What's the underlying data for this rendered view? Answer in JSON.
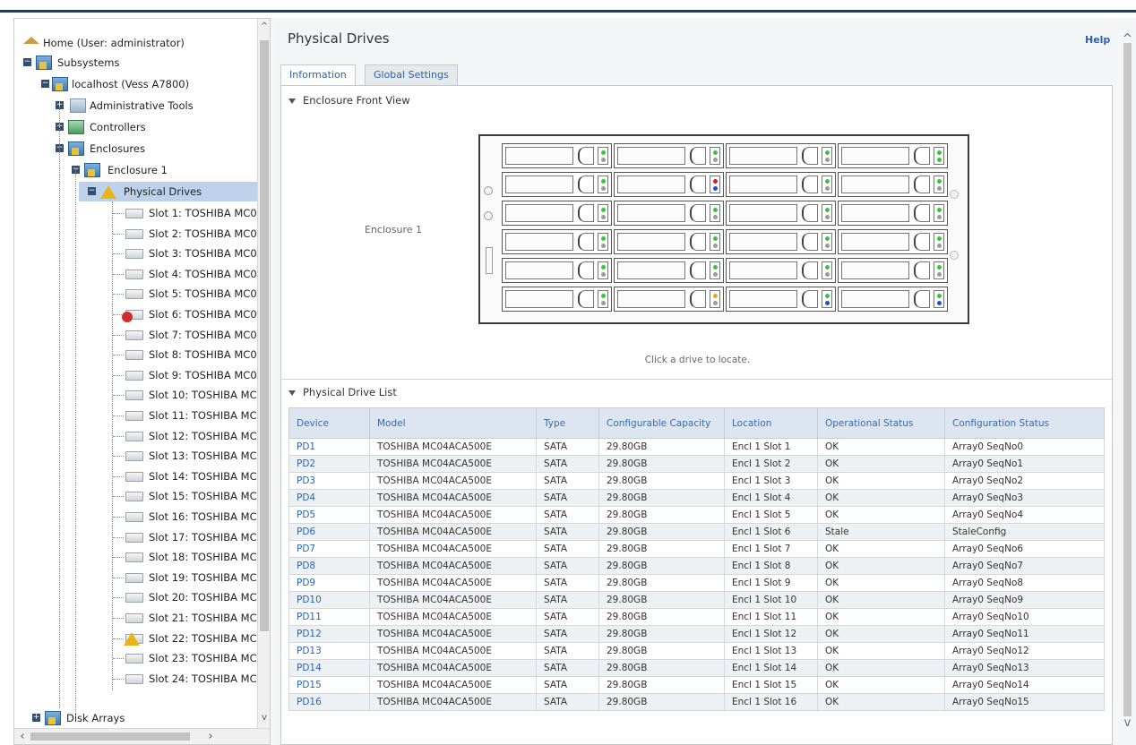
{
  "tree": {
    "home": "Home (User: administrator)",
    "subsystems": "Subsystems",
    "localhost": "localhost (Vess A7800)",
    "admin_tools": "Administrative Tools",
    "controllers": "Controllers",
    "enclosures": "Enclosures",
    "enclosure1": "Enclosure 1",
    "physical_drives": "Physical Drives",
    "disk_arrays": "Disk Arrays",
    "slots": [
      "Slot 1: TOSHIBA MC0",
      "Slot 2: TOSHIBA MC0",
      "Slot 3: TOSHIBA MC0",
      "Slot 4: TOSHIBA MC0",
      "Slot 5: TOSHIBA MC0",
      "Slot 6: TOSHIBA MC0",
      "Slot 7: TOSHIBA MC0",
      "Slot 8: TOSHIBA MC0",
      "Slot 9: TOSHIBA MC0",
      "Slot 10: TOSHIBA MC",
      "Slot 11: TOSHIBA MC",
      "Slot 12: TOSHIBA MC",
      "Slot 13: TOSHIBA MC",
      "Slot 14: TOSHIBA MC",
      "Slot 15: TOSHIBA MC",
      "Slot 16: TOSHIBA MC",
      "Slot 17: TOSHIBA MC",
      "Slot 18: TOSHIBA MC",
      "Slot 19: TOSHIBA MC",
      "Slot 20: TOSHIBA MC",
      "Slot 21: TOSHIBA MC",
      "Slot 22: TOSHIBA MC",
      "Slot 23: TOSHIBA MC",
      "Slot 24: TOSHIBA MC"
    ],
    "slot_status": [
      "ok",
      "ok",
      "ok",
      "ok",
      "ok",
      "error",
      "ok",
      "ok",
      "ok",
      "ok",
      "ok",
      "ok",
      "ok",
      "ok",
      "ok",
      "ok",
      "ok",
      "ok",
      "ok",
      "ok",
      "ok",
      "warning",
      "ok",
      "ok"
    ]
  },
  "header": {
    "title": "Physical Drives",
    "help": "Help"
  },
  "tabs": [
    {
      "label": "Information",
      "active": true
    },
    {
      "label": "Global Settings",
      "active": false
    }
  ],
  "front_view": {
    "heading": "Enclosure Front View",
    "enclosure_label": "Enclosure 1",
    "hint": "Click a drive to locate.",
    "led_colors": {
      "green": "#3cc43c",
      "red": "#d02020",
      "blue": "#2050c8",
      "orange": "#e8a030",
      "gray": "#9a9a9a"
    },
    "bays": [
      [
        [
          "green",
          "gray"
        ],
        [
          "green",
          "gray"
        ],
        [
          "green",
          "gray"
        ],
        [
          "green",
          "green"
        ]
      ],
      [
        [
          "green",
          "gray"
        ],
        [
          "red",
          "blue"
        ],
        [
          "green",
          "gray"
        ],
        [
          "green",
          "gray"
        ]
      ],
      [
        [
          "green",
          "gray"
        ],
        [
          "green",
          "gray"
        ],
        [
          "green",
          "gray"
        ],
        [
          "green",
          "gray"
        ]
      ],
      [
        [
          "green",
          "gray"
        ],
        [
          "green",
          "gray"
        ],
        [
          "green",
          "gray"
        ],
        [
          "green",
          "gray"
        ]
      ],
      [
        [
          "green",
          "gray"
        ],
        [
          "green",
          "gray"
        ],
        [
          "green",
          "gray"
        ],
        [
          "green",
          "gray"
        ]
      ],
      [
        [
          "green",
          "gray"
        ],
        [
          "orange",
          "gray"
        ],
        [
          "green",
          "blue"
        ],
        [
          "green",
          "blue"
        ]
      ]
    ]
  },
  "drive_list": {
    "heading": "Physical Drive List",
    "columns": [
      "Device",
      "Model",
      "Type",
      "Configurable Capacity",
      "Location",
      "Operational Status",
      "Configuration Status"
    ],
    "rows": [
      [
        "PD1",
        "TOSHIBA MC04ACA500E",
        "SATA",
        "29.80GB",
        "Encl 1 Slot 1",
        "OK",
        "Array0 SeqNo0"
      ],
      [
        "PD2",
        "TOSHIBA MC04ACA500E",
        "SATA",
        "29.80GB",
        "Encl 1 Slot 2",
        "OK",
        "Array0 SeqNo1"
      ],
      [
        "PD3",
        "TOSHIBA MC04ACA500E",
        "SATA",
        "29.80GB",
        "Encl 1 Slot 3",
        "OK",
        "Array0 SeqNo2"
      ],
      [
        "PD4",
        "TOSHIBA MC04ACA500E",
        "SATA",
        "29.80GB",
        "Encl 1 Slot 4",
        "OK",
        "Array0 SeqNo3"
      ],
      [
        "PD5",
        "TOSHIBA MC04ACA500E",
        "SATA",
        "29.80GB",
        "Encl 1 Slot 5",
        "OK",
        "Array0 SeqNo4"
      ],
      [
        "PD6",
        "TOSHIBA MC04ACA500E",
        "SATA",
        "29.80GB",
        "Encl 1 Slot 6",
        "Stale",
        "StaleConfig"
      ],
      [
        "PD7",
        "TOSHIBA MC04ACA500E",
        "SATA",
        "29.80GB",
        "Encl 1 Slot 7",
        "OK",
        "Array0 SeqNo6"
      ],
      [
        "PD8",
        "TOSHIBA MC04ACA500E",
        "SATA",
        "29.80GB",
        "Encl 1 Slot 8",
        "OK",
        "Array0 SeqNo7"
      ],
      [
        "PD9",
        "TOSHIBA MC04ACA500E",
        "SATA",
        "29.80GB",
        "Encl 1 Slot 9",
        "OK",
        "Array0 SeqNo8"
      ],
      [
        "PD10",
        "TOSHIBA MC04ACA500E",
        "SATA",
        "29.80GB",
        "Encl 1 Slot 10",
        "OK",
        "Array0 SeqNo9"
      ],
      [
        "PD11",
        "TOSHIBA MC04ACA500E",
        "SATA",
        "29.80GB",
        "Encl 1 Slot 11",
        "OK",
        "Array0 SeqNo10"
      ],
      [
        "PD12",
        "TOSHIBA MC04ACA500E",
        "SATA",
        "29.80GB",
        "Encl 1 Slot 12",
        "OK",
        "Array0 SeqNo11"
      ],
      [
        "PD13",
        "TOSHIBA MC04ACA500E",
        "SATA",
        "29.80GB",
        "Encl 1 Slot 13",
        "OK",
        "Array0 SeqNo12"
      ],
      [
        "PD14",
        "TOSHIBA MC04ACA500E",
        "SATA",
        "29.80GB",
        "Encl 1 Slot 14",
        "OK",
        "Array0 SeqNo13"
      ],
      [
        "PD15",
        "TOSHIBA MC04ACA500E",
        "SATA",
        "29.80GB",
        "Encl 1 Slot 15",
        "OK",
        "Array0 SeqNo14"
      ],
      [
        "PD16",
        "TOSHIBA MC04ACA500E",
        "SATA",
        "29.80GB",
        "Encl 1 Slot 16",
        "OK",
        "Array0 SeqNo15"
      ]
    ]
  }
}
